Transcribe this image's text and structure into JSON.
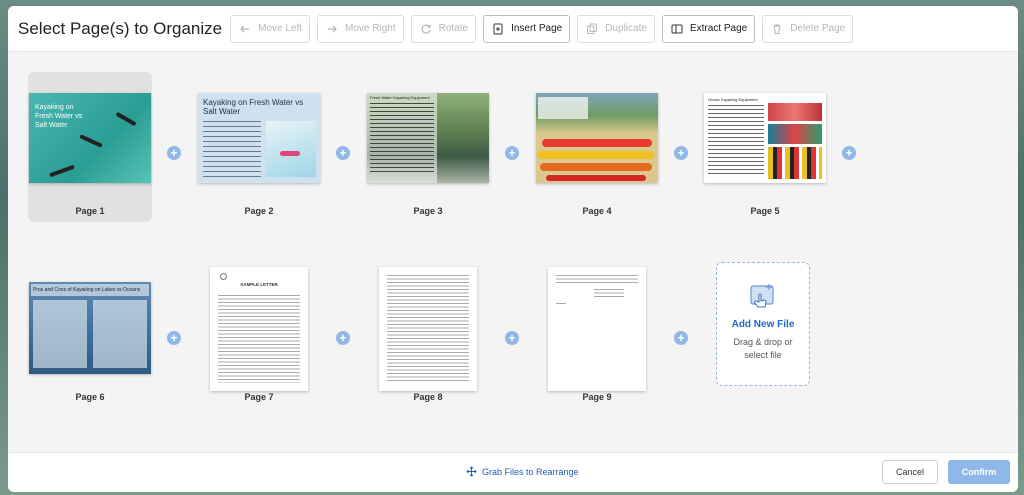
{
  "header": {
    "title": "Select Page(s) to Organize",
    "buttons": {
      "move_left": "Move Left",
      "move_right": "Move Right",
      "rotate": "Rotate",
      "insert_page": "Insert Page",
      "duplicate": "Duplicate",
      "extract_page": "Extract Page",
      "delete_page": "Delete Page"
    }
  },
  "pages": [
    {
      "label": "Page 1",
      "thumb_text": "Kayaking on Fresh Water vs Salt Water"
    },
    {
      "label": "Page 2",
      "thumb_text": "Kayaking on Fresh Water vs Salt Water"
    },
    {
      "label": "Page 3",
      "thumb_text": "Fresh Water Kayaking Equipment"
    },
    {
      "label": "Page 4"
    },
    {
      "label": "Page 5",
      "thumb_text": "Ocean Kayaking Equipment"
    },
    {
      "label": "Page 6",
      "thumb_text": "Pros and Cons of Kayaking on Lakes vs Oceans"
    },
    {
      "label": "Page 7",
      "thumb_text": "SAMPLE LETTER"
    },
    {
      "label": "Page 8"
    },
    {
      "label": "Page 9"
    }
  ],
  "add_file": {
    "title": "Add New File",
    "subtitle": "Drag & drop or select file"
  },
  "footer": {
    "grab_label": "Grab Files to Rearrange",
    "cancel_label": "Cancel",
    "confirm_label": "Confirm"
  },
  "colors": {
    "accent": "#2268c8",
    "plus": "#8fb8e9",
    "selected_card": "#e1e1e1"
  }
}
